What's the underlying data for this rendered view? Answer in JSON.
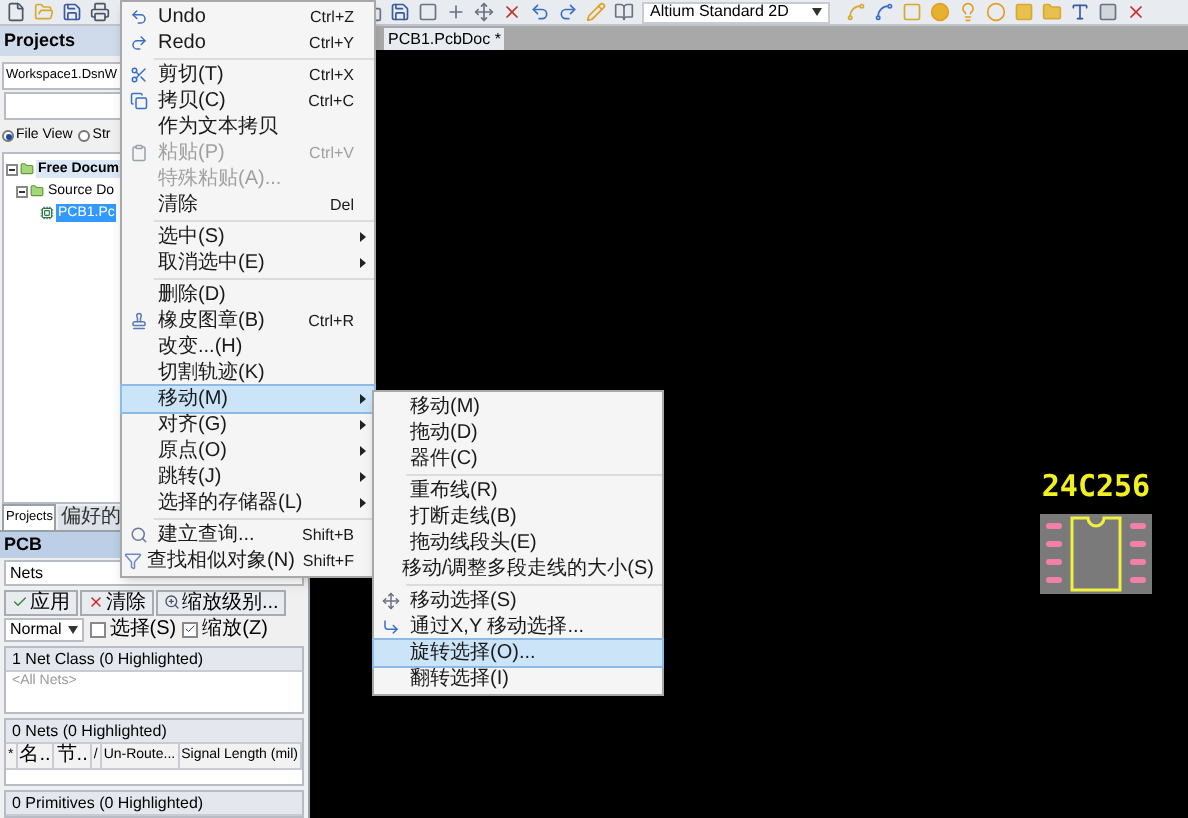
{
  "toolbar": {
    "view_mode": "Altium Standard 2D"
  },
  "projects_panel": {
    "title": "Projects",
    "workspace": "Workspace1.DsnW",
    "view_options": [
      {
        "label": "File View",
        "selected": true
      },
      {
        "label": "Str",
        "selected": false
      }
    ],
    "tree": [
      {
        "label": "Free Docum",
        "selected": false,
        "expanded": true,
        "children": [
          {
            "label": "Source Do",
            "selected": false,
            "expanded": true,
            "children": [
              {
                "label": "PCB1.Pc",
                "selected": true
              }
            ]
          }
        ]
      }
    ]
  },
  "panel_tabs": [
    {
      "label": "Projects",
      "selected": true
    },
    {
      "label": "偏好的",
      "selected": false
    }
  ],
  "pcb_panel": {
    "title": "PCB",
    "filter": "Nets",
    "buttons": [
      {
        "label": "应用"
      },
      {
        "label": "清除"
      },
      {
        "label": "缩放级别..."
      }
    ],
    "mode": "Normal",
    "options": [
      {
        "label": "选择(S)",
        "checked": false
      },
      {
        "label": "缩放(Z)",
        "checked": true
      }
    ],
    "net_class_section": {
      "title": "1 Net Class (0 Highlighted)",
      "items": [
        "<All Nets>"
      ]
    },
    "nets_section": {
      "title": "0 Nets (0 Highlighted)",
      "columns": [
        "*",
        "名..",
        "节..",
        "/",
        "Un-Route...",
        "Signal Length (mil)"
      ]
    },
    "primitives_section": {
      "title": "0 Primitives (0 Highlighted)"
    }
  },
  "document_tabs": [
    {
      "label": "PCB1.PcbDoc *",
      "selected": true
    }
  ],
  "canvas": {
    "component_label": "24C256"
  },
  "edit_menu": {
    "groups": [
      [
        {
          "label": "Undo",
          "shortcut": "Ctrl+Z",
          "submenu": false,
          "disabled": false,
          "selected": false
        },
        {
          "label": "Redo",
          "shortcut": "Ctrl+Y",
          "submenu": false,
          "disabled": false,
          "selected": false
        }
      ],
      [
        {
          "label": "剪切(T)",
          "shortcut": "Ctrl+X",
          "submenu": false,
          "disabled": false,
          "selected": false
        },
        {
          "label": "拷贝(C)",
          "shortcut": "Ctrl+C",
          "submenu": false,
          "disabled": false,
          "selected": false
        },
        {
          "label": "作为文本拷贝",
          "submenu": false,
          "disabled": false,
          "selected": false
        },
        {
          "label": "粘贴(P)",
          "shortcut": "Ctrl+V",
          "submenu": false,
          "disabled": true,
          "selected": false
        },
        {
          "label": "特殊粘贴(A)...",
          "submenu": false,
          "disabled": true,
          "selected": false
        },
        {
          "label": "清除",
          "shortcut": "Del",
          "submenu": false,
          "disabled": false,
          "selected": false
        }
      ],
      [
        {
          "label": "选中(S)",
          "submenu": true,
          "disabled": false,
          "selected": false
        },
        {
          "label": "取消选中(E)",
          "submenu": true,
          "disabled": false,
          "selected": false
        }
      ],
      [
        {
          "label": "删除(D)",
          "submenu": false,
          "disabled": false,
          "selected": false
        },
        {
          "label": "橡皮图章(B)",
          "shortcut": "Ctrl+R",
          "submenu": false,
          "disabled": false,
          "selected": false
        },
        {
          "label": "改变...(H)",
          "submenu": false,
          "disabled": false,
          "selected": false
        },
        {
          "label": "切割轨迹(K)",
          "submenu": false,
          "disabled": false,
          "selected": false
        },
        {
          "label": "移动(M)",
          "submenu": true,
          "disabled": false,
          "selected": true
        },
        {
          "label": "对齐(G)",
          "submenu": true,
          "disabled": false,
          "selected": false
        },
        {
          "label": "原点(O)",
          "submenu": true,
          "disabled": false,
          "selected": false
        },
        {
          "label": "跳转(J)",
          "submenu": true,
          "disabled": false,
          "selected": false
        },
        {
          "label": "选择的存储器(L)",
          "submenu": true,
          "disabled": false,
          "selected": false
        }
      ],
      [
        {
          "label": "建立查询...",
          "shortcut": "Shift+B",
          "submenu": false,
          "disabled": false,
          "selected": false
        },
        {
          "label": "查找相似对象(N)",
          "shortcut": "Shift+F",
          "submenu": false,
          "disabled": false,
          "selected": false
        }
      ]
    ]
  },
  "move_submenu": {
    "groups": [
      [
        {
          "label": "移动(M)",
          "selected": false
        },
        {
          "label": "拖动(D)",
          "selected": false
        },
        {
          "label": "器件(C)",
          "selected": false
        }
      ],
      [
        {
          "label": "重布线(R)",
          "selected": false
        },
        {
          "label": "打断走线(B)",
          "selected": false
        },
        {
          "label": "拖动线段头(E)",
          "selected": false
        },
        {
          "label": "移动/调整多段走线的大小(S)",
          "selected": false
        }
      ],
      [
        {
          "label": "移动选择(S)",
          "selected": false
        },
        {
          "label": "通过X,Y 移动选择...",
          "selected": false
        },
        {
          "label": "旋转选择(O)...",
          "selected": true
        },
        {
          "label": "翻转选择(I)",
          "selected": false
        }
      ]
    ]
  }
}
